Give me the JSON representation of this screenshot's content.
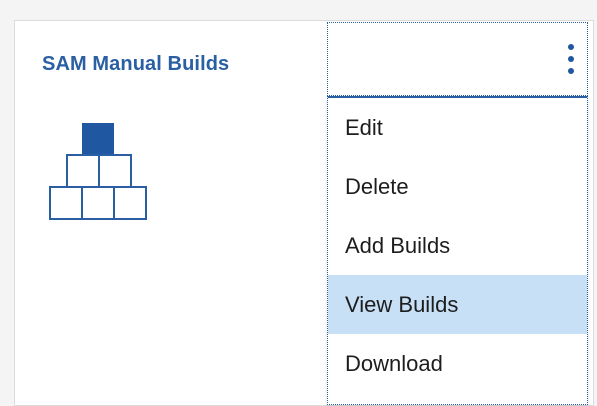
{
  "card": {
    "title": "SAM Manual Builds"
  },
  "icons": {
    "overflow": "kebab-vertical-icon",
    "card": "pyramid-builds-icon"
  },
  "colors": {
    "accent": "#2a5fa3",
    "highlight": "#c8e0f6"
  },
  "menu": {
    "items": [
      {
        "label": "Edit"
      },
      {
        "label": "Delete"
      },
      {
        "label": "Add Builds"
      },
      {
        "label": "View Builds",
        "highlighted": true
      },
      {
        "label": "Download"
      }
    ]
  }
}
